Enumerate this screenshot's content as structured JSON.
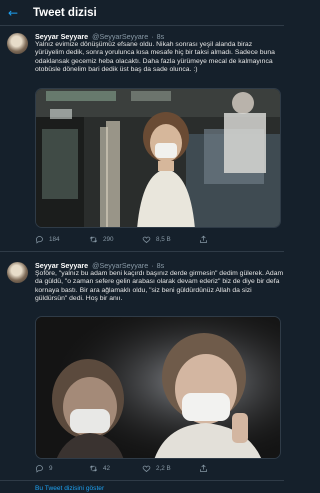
{
  "header": {
    "title": "Tweet dizisi"
  },
  "tweets": [
    {
      "name": "Seyyar Seyyare",
      "handle": "@SeyyarSeyyare",
      "time": "8s",
      "text": "Yalnız evimize dönüşümüz efsane oldu. Nikah sonrası yeşil alanda biraz yürüyelim dedik, sonra yorulunca kısa mesafe hiç bir taksi almadı. Sadece buna odaklansak gecemiz heba olacaktı. Daha fazla yürümeye mecal de kalmayınca otobüsle dönelim bari dedik üst baş da sade olunca. :)",
      "replies": "184",
      "retweets": "290",
      "likes": "8,5 B"
    },
    {
      "name": "Seyyar Seyyare",
      "handle": "@SeyyarSeyyare",
      "time": "8s",
      "text": "Şoföre, \"yalnız bu adam beni kaçırdı başınız derde girmesin\" dedim gülerek. Adam da güldü, \"o zaman sefere gelin arabası olarak devam ederiz\" biz de diye bir defa kornaya bastı. Bir ara ağlamaklı oldu, \"siz beni güldürdünüz Allah da sizi güldürsün\" dedi. Hoş bir anıı.",
      "replies": "9",
      "retweets": "42",
      "likes": "2,2 B"
    }
  ],
  "footer": {
    "show_thread": "Bu Tweet dizisini göster"
  },
  "colors": {
    "background": "#15202b",
    "accent": "#1da1f2",
    "muted": "#8899a6"
  },
  "icons": {
    "back": "arrow-left-icon",
    "reply": "reply-icon",
    "retweet": "retweet-icon",
    "like": "heart-icon",
    "share": "share-icon"
  }
}
